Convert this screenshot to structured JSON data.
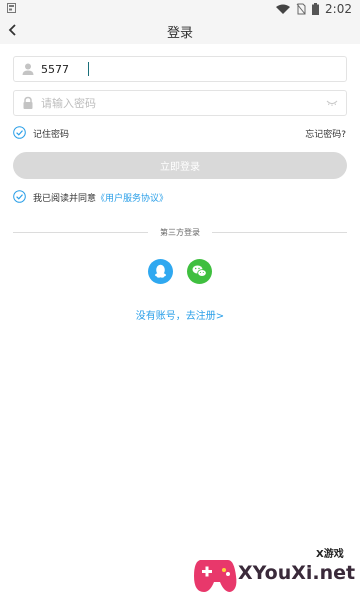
{
  "status_bar": {
    "time": "2:02"
  },
  "header": {
    "title": "登录"
  },
  "form": {
    "account_value": "5577",
    "password_placeholder": "请输入密码",
    "remember_label": "记住密码",
    "forgot_label": "忘记密码?",
    "login_button_label": "立即登录",
    "agree_prefix": "我已阅读并同意",
    "agree_link": "《用户服务协议》"
  },
  "third_party": {
    "divider_label": "第三方登录",
    "icons": [
      "qq-icon",
      "wechat-icon"
    ]
  },
  "register": {
    "label": "没有账号，去注册>"
  },
  "watermark": {
    "small": "X游戏",
    "big": "XYouXi.net"
  },
  "colors": {
    "accent": "#2a9fe8",
    "button_disabled": "#d9d9d9",
    "qq": "#2fa8f0",
    "wechat": "#3fbf3f"
  }
}
